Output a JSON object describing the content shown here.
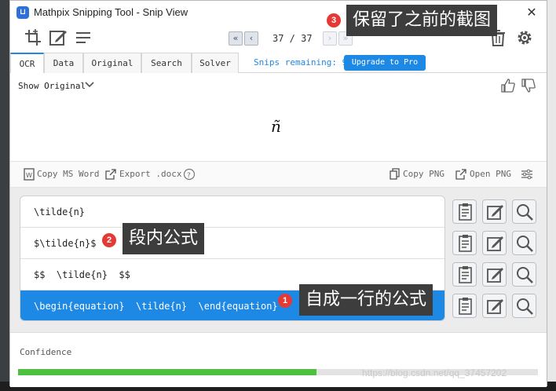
{
  "window": {
    "title": "Mathpix Snipping Tool - Snip View",
    "close_glyph": "✕"
  },
  "toolbar": {
    "icons": [
      "crop-icon",
      "edit-icon",
      "menu-icon"
    ],
    "page_counter": "37 / 37",
    "nav": {
      "first": "«",
      "prev": "‹",
      "next": "›",
      "last": "»"
    }
  },
  "tabs": [
    {
      "label": "OCR",
      "active": true
    },
    {
      "label": "Data",
      "active": false
    },
    {
      "label": "Original",
      "active": false
    },
    {
      "label": "Search",
      "active": false
    },
    {
      "label": "Solver",
      "active": false
    }
  ],
  "snips_remaining": "Snips remaining: 9",
  "upgrade_label": "Upgrade to Pro",
  "preview": {
    "show_original_label": "Show Original",
    "formula": "ñ"
  },
  "actions": {
    "copy_ms_word": "Copy MS Word",
    "export_docx": "Export .docx",
    "copy_png": "Copy PNG",
    "open_png": "Open PNG"
  },
  "results": [
    {
      "latex": "\\tilde{n}",
      "selected": false
    },
    {
      "latex": "$\\tilde{n}$",
      "selected": false
    },
    {
      "latex": "$$  \\tilde{n}  $$",
      "selected": false
    },
    {
      "latex": "\\begin{equation}  \\tilde{n}  \\end{equation}",
      "selected": true
    }
  ],
  "confidence": {
    "label": "Confidence",
    "value": 0.574
  },
  "watermark": "https://blog.csdn.net/qq_37457202",
  "annotations": [
    {
      "number": "3",
      "text": "保留了之前的截图"
    },
    {
      "number": "2",
      "text": "段内公式"
    },
    {
      "number": "1",
      "text": "自成一行的公式"
    }
  ],
  "colors": {
    "accent": "#1e88e5",
    "confidence_bar": "#4cc03f",
    "badge": "#e53935",
    "callout_bg": "#3d3d3d"
  }
}
